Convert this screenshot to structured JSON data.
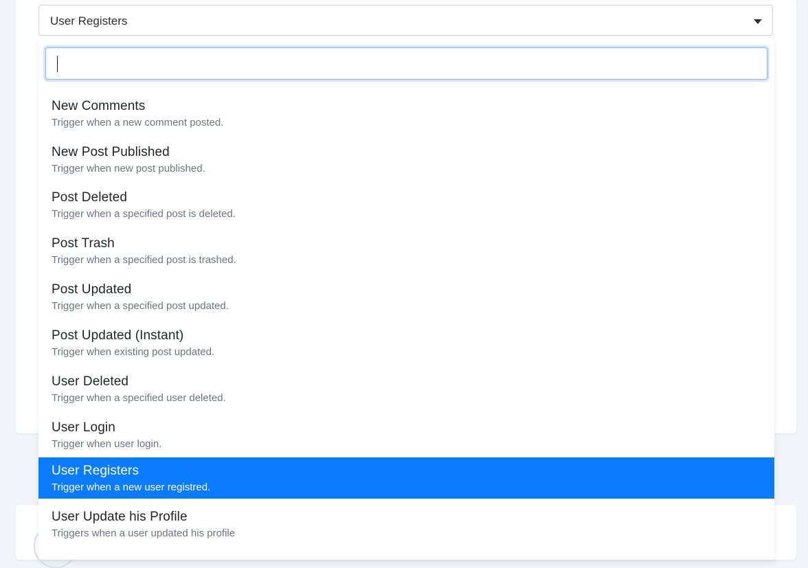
{
  "select": {
    "selected_value": "User Registers",
    "search_value": "",
    "options": [
      {
        "title": "New Comments",
        "description": "Trigger when a new comment posted."
      },
      {
        "title": "New Post Published",
        "description": "Trigger when new post published."
      },
      {
        "title": "Post Deleted",
        "description": "Trigger when a specified post is deleted."
      },
      {
        "title": "Post Trash",
        "description": "Trigger when a specified post is trashed."
      },
      {
        "title": "Post Updated",
        "description": "Trigger when a specified post updated."
      },
      {
        "title": "Post Updated (Instant)",
        "description": "Trigger when existing post updated."
      },
      {
        "title": "User Deleted",
        "description": "Trigger when a specified user deleted."
      },
      {
        "title": "User Login",
        "description": "Trigger when user login."
      },
      {
        "title": "User Registers",
        "description": "Trigger when a new user registred.",
        "highlighted": true
      },
      {
        "title": "User Update his Profile",
        "description": "Triggers when a user updated his profile"
      }
    ]
  },
  "colors": {
    "highlight": "#0b7bff",
    "page_background": "#f1f4f8",
    "focus_border": "#86b7fe"
  },
  "icons": {
    "caret": "caret-down-icon"
  }
}
